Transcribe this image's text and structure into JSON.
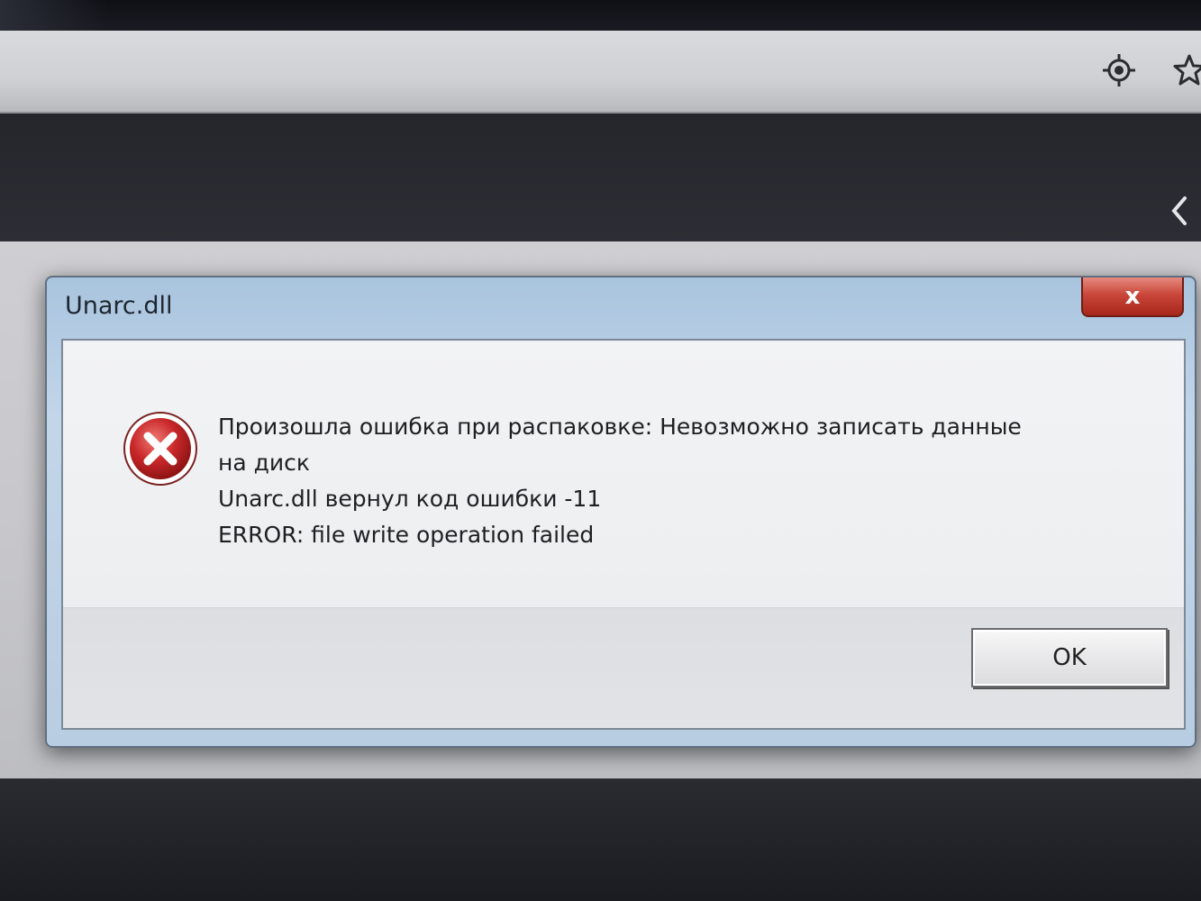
{
  "dialog": {
    "title": "Unarc.dll",
    "close_label": "x",
    "message_lines": [
      "Произошла ошибка при распаковке: Невозможно записать данные",
      "на диск",
      "Unarc.dll вернул код ошибки -11",
      "ERROR: file write operation failed"
    ],
    "ok_label": "OK",
    "icon": "error-icon"
  },
  "browser": {
    "toolbar_icons": [
      "location-icon",
      "star-icon"
    ],
    "panel_icon": "chevron-left-icon"
  },
  "colors": {
    "error_red": "#c0282a",
    "close_red": "#c9473a",
    "title_bar_blue": "#b8cde2"
  }
}
